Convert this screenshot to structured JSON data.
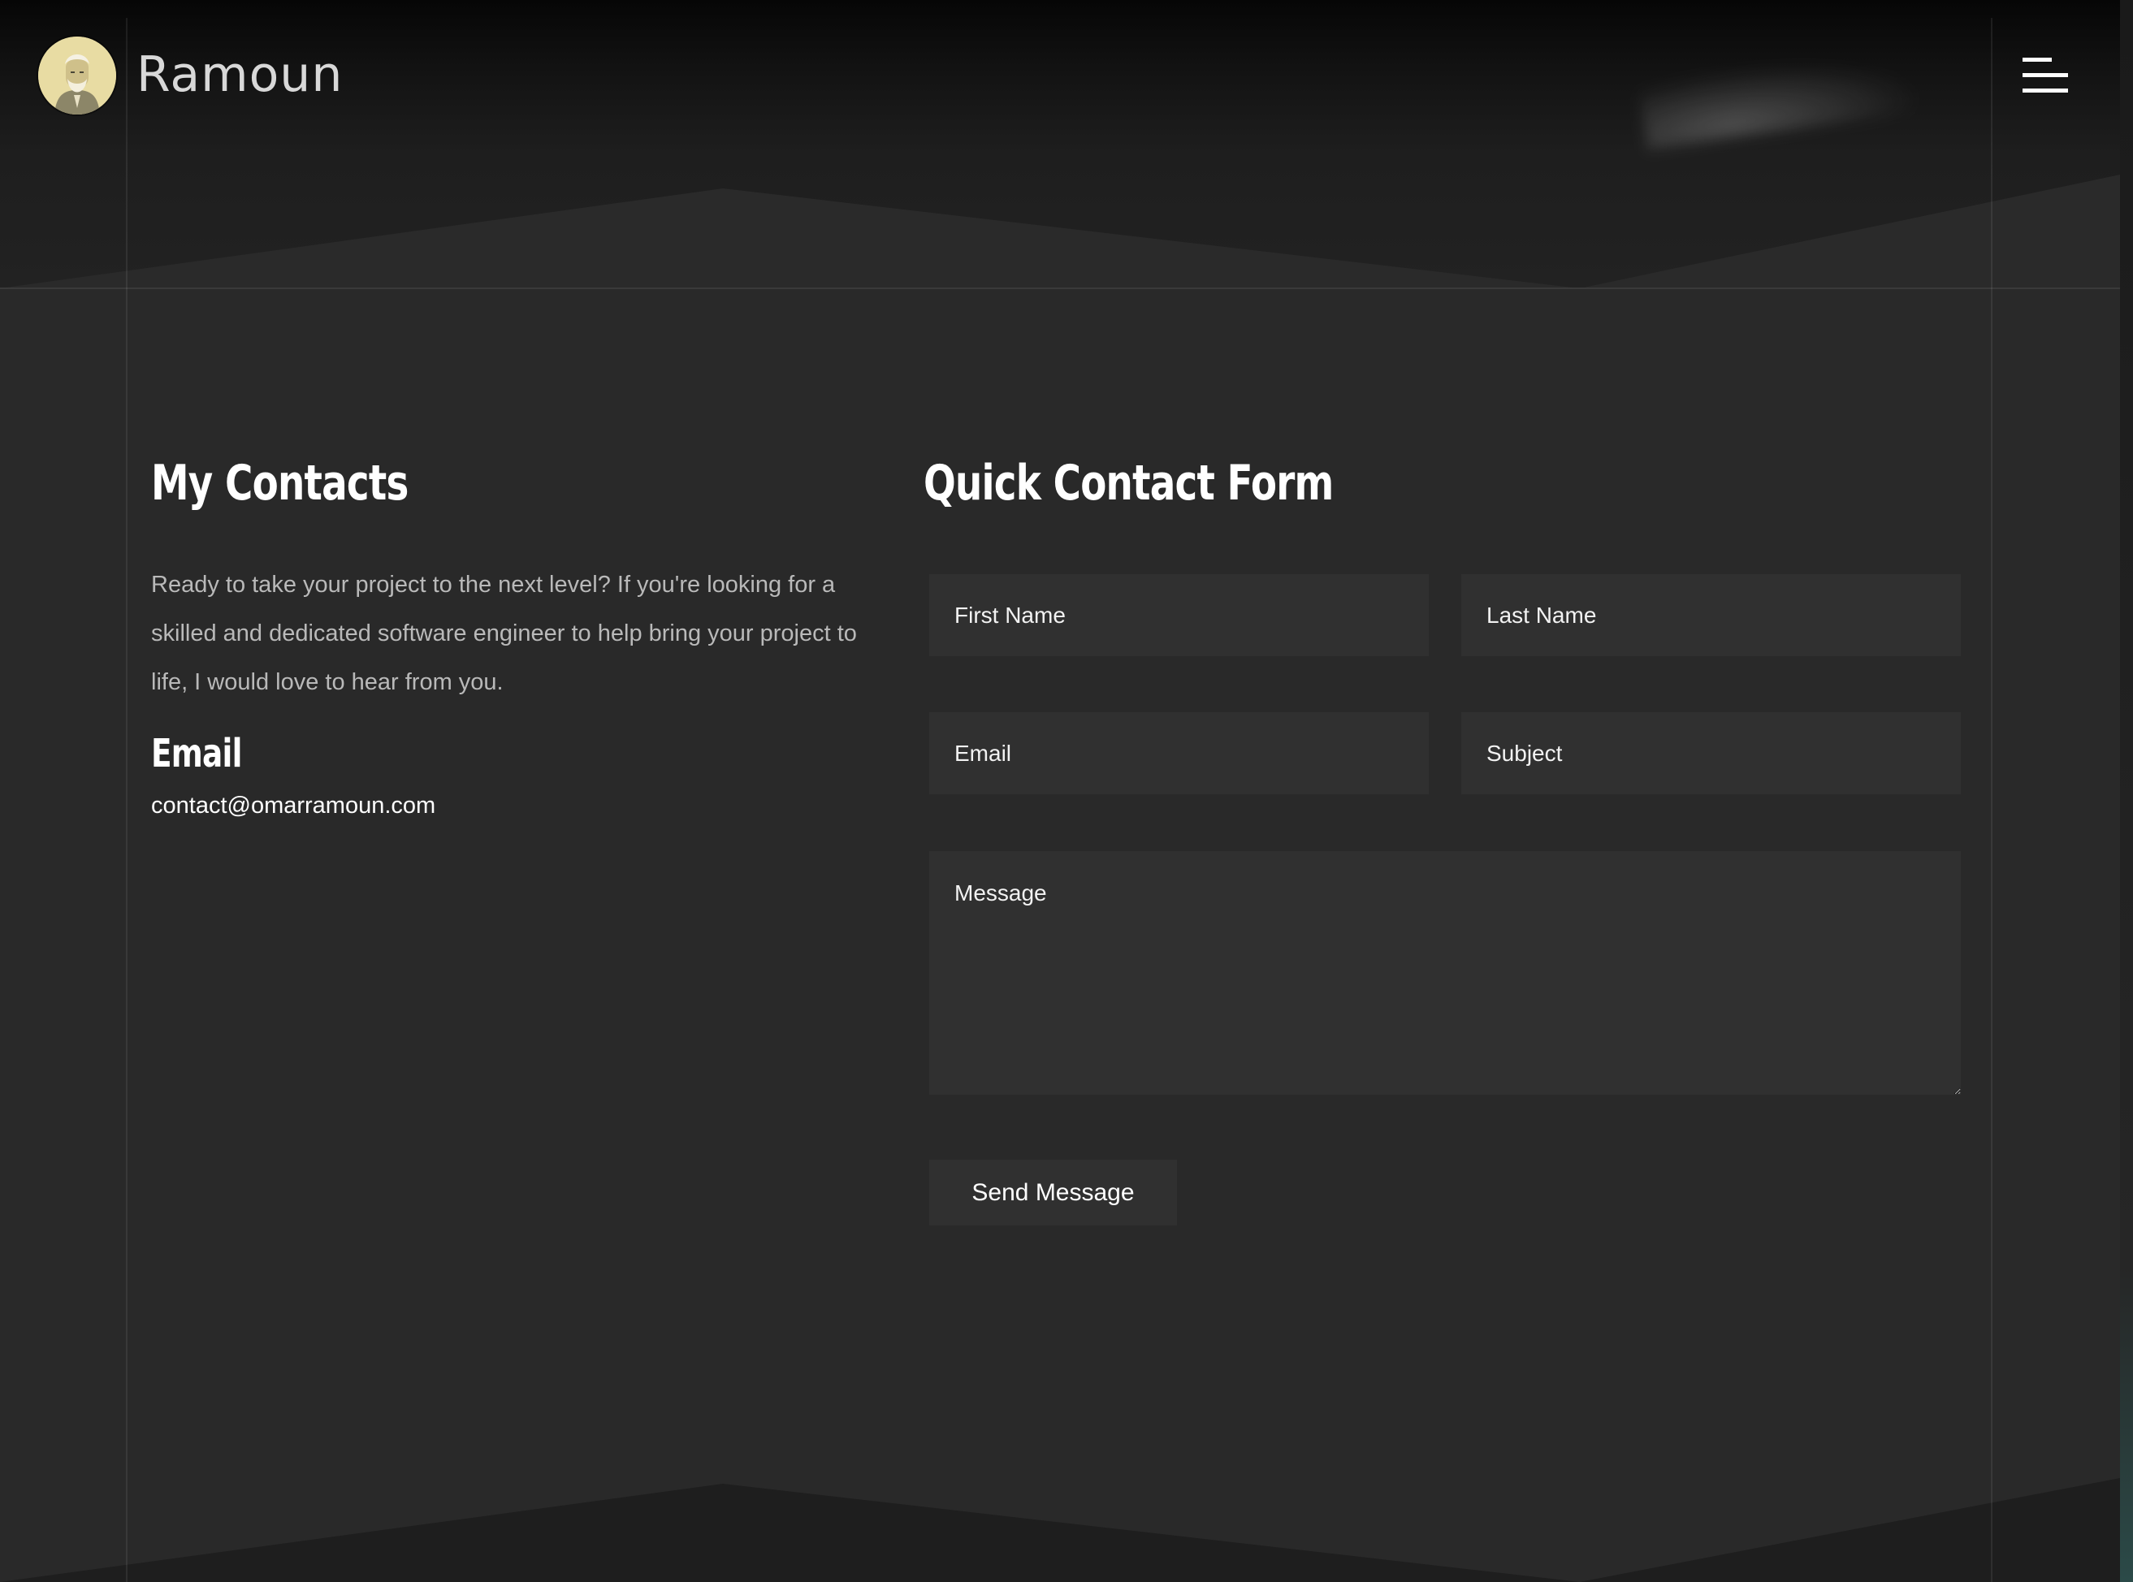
{
  "header": {
    "brand": "Ramoun",
    "logo_icon": "bearded-man-portrait-icon",
    "menu_icon": "hamburger-menu-icon"
  },
  "contacts": {
    "title": "My Contacts",
    "intro": "Ready to take your project to the next level? If you're looking for a skilled and dedicated software engineer to help bring your project to life, I would love to hear from you.",
    "email_title": "Email",
    "email_value": "contact@omarramoun.com"
  },
  "form": {
    "title": "Quick Contact Form",
    "first_name_placeholder": "First Name",
    "last_name_placeholder": "Last Name",
    "email_placeholder": "Email",
    "subject_placeholder": "Subject",
    "message_placeholder": "Message",
    "submit_label": "Send Message"
  },
  "colors": {
    "background": "#292929",
    "field_background": "#303030",
    "text": "#ffffff",
    "muted_text": "#b9b9b9"
  }
}
